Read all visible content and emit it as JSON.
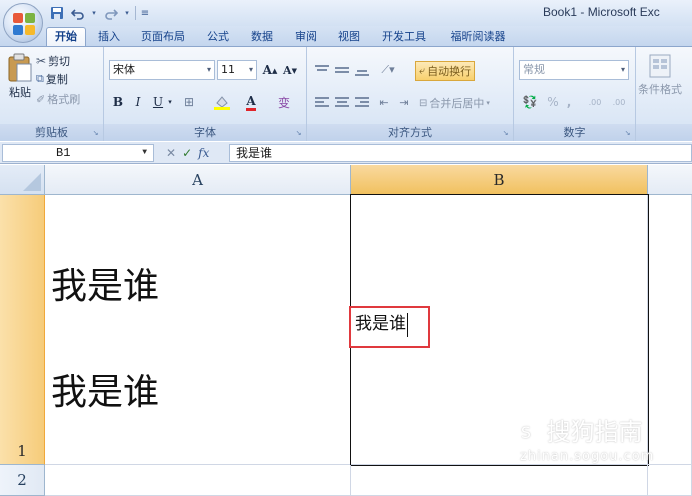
{
  "window": {
    "title": "Book1 - Microsoft Exc"
  },
  "quick_access": {
    "icons": [
      "save-icon",
      "undo-icon",
      "redo-icon",
      "customize-icon"
    ]
  },
  "tabs": [
    {
      "label": "开始",
      "active": true
    },
    {
      "label": "插入"
    },
    {
      "label": "页面布局"
    },
    {
      "label": "公式"
    },
    {
      "label": "数据"
    },
    {
      "label": "审阅"
    },
    {
      "label": "视图"
    },
    {
      "label": "开发工具"
    },
    {
      "label": "福昕阅读器"
    }
  ],
  "ribbon": {
    "clipboard": {
      "label": "剪贴板",
      "paste": "粘贴",
      "cut": "剪切",
      "copy": "复制",
      "format_painter": "格式刷"
    },
    "font": {
      "label": "字体",
      "font_name": "宋体",
      "font_size": "11",
      "increase_size": "A",
      "decrease_size": "A",
      "bold": "B",
      "italic": "I",
      "underline": "U",
      "font_color_glyph": "A",
      "phonetic_glyph": "变"
    },
    "alignment": {
      "label": "对齐方式",
      "wrap_text": "自动换行",
      "merge_center": "合并后居中"
    },
    "number": {
      "label": "数字",
      "format": "常规",
      "percent": "%",
      "comma": ",",
      "increase_decimal": ".00",
      "decrease_decimal": ".00"
    },
    "styles": {
      "conditional_format": "条件格式"
    }
  },
  "formula_bar": {
    "name_box": "B1",
    "fx": "fx",
    "content": "我是谁"
  },
  "sheet": {
    "columns": [
      "A",
      "B"
    ],
    "rows": [
      "1",
      "2"
    ],
    "selected_column": "B",
    "selected_row": "1",
    "active_cell": "B1",
    "cell_a1_lines": [
      "我是谁",
      "我是谁"
    ],
    "cell_b1_editing": "我是谁"
  },
  "watermark": {
    "text": "搜狗指南",
    "url": "zhinan.sogou.com"
  },
  "colors": {
    "selected_header": "#f6cc7a",
    "edit_border": "#e0393e",
    "ribbon_text": "#15428b"
  }
}
